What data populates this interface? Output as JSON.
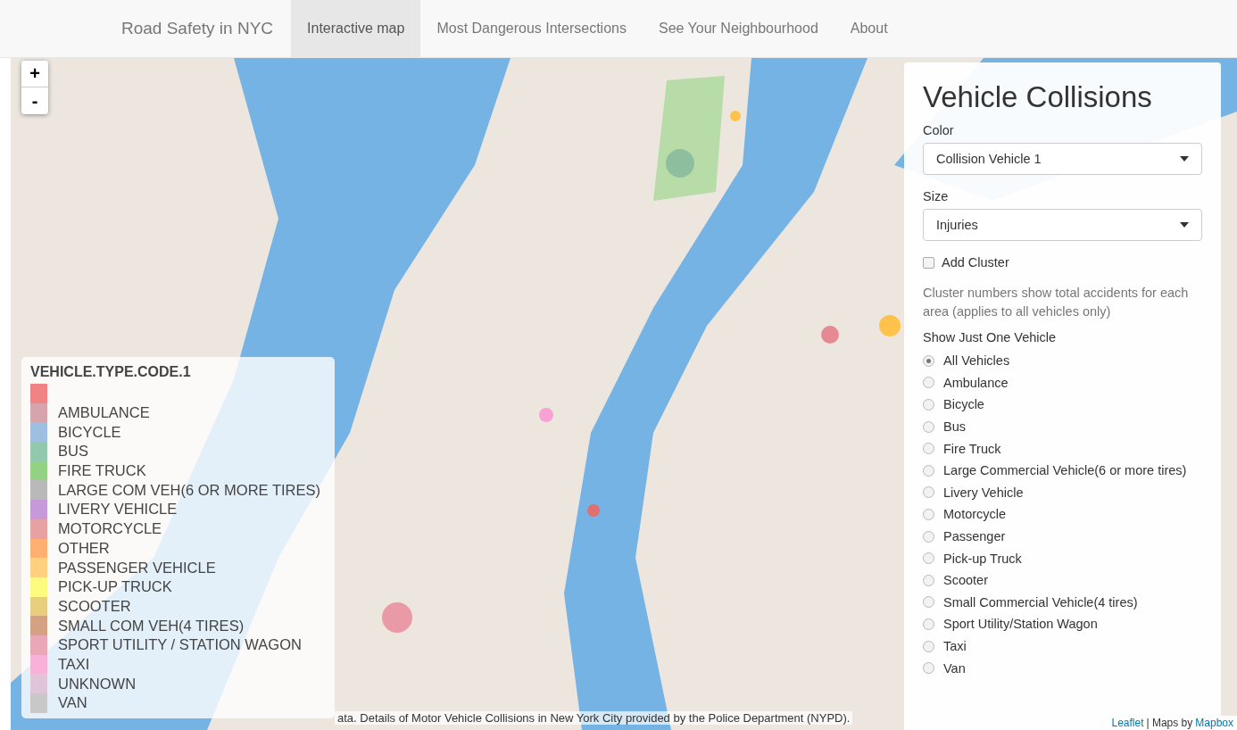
{
  "navbar": {
    "brand": "Road Safety in NYC",
    "tabs": [
      {
        "label": "Interactive map",
        "selected": true
      },
      {
        "label": "Most Dangerous Intersections",
        "selected": false
      },
      {
        "label": "See Your Neighbourhood",
        "selected": false
      },
      {
        "label": "About",
        "selected": false
      }
    ]
  },
  "map": {
    "kind": "picture",
    "zoom_in": "+",
    "zoom_out": "-"
  },
  "legend": {
    "title": "VEHICLE.TYPE.CODE.1",
    "items": [
      {
        "color": "#f08484"
      },
      {
        "label": "AMBULANCE",
        "color": "#d8a4ac"
      },
      {
        "label": "BICYCLE",
        "color": "#9fbfe0"
      },
      {
        "label": "BUS",
        "color": "#92c9ac"
      },
      {
        "label": "FIRE TRUCK",
        "color": "#94d184"
      },
      {
        "label": "LARGE COM VEH(6 OR MORE TIRES)",
        "color": "#b9b9b9"
      },
      {
        "label": "LIVERY VEHICLE",
        "color": "#c69ad8"
      },
      {
        "label": "MOTORCYCLE",
        "color": "#e6a2a2"
      },
      {
        "label": "OTHER",
        "color": "#ffb070"
      },
      {
        "label": "PASSENGER VEHICLE",
        "color": "#ffd07e"
      },
      {
        "label": "PICK-UP TRUCK",
        "color": "#fffa80"
      },
      {
        "label": "SCOOTER",
        "color": "#e8cf80"
      },
      {
        "label": "SMALL COM VEH(4 TIRES)",
        "color": "#d2a282"
      },
      {
        "label": "SPORT UTILITY / STATION WAGON",
        "color": "#e8a8b6"
      },
      {
        "label": "TAXI",
        "color": "#f8b2da"
      },
      {
        "label": "UNKNOWN",
        "color": "#e0c4d8"
      },
      {
        "label": "VAN",
        "color": "#c8c8c8"
      }
    ]
  },
  "attribution": {
    "text": "ata. Details of Motor Vehicle Collisions in New York City provided by the Police Department (NYPD).",
    "leaflet_link": "Leaflet",
    "separator": "| Maps by",
    "mapbox_link": "Mapbox"
  },
  "panel": {
    "title": "Vehicle Collisions",
    "color_label": "Color",
    "color_value": "Collision Vehicle 1",
    "size_label": "Size",
    "size_value": "Injuries",
    "cluster": {
      "label": "Add Cluster",
      "checked": false
    },
    "help": "Cluster numbers show total accidents for each area (applies to all vehicles only)",
    "vehicle_label": "Show Just One Vehicle",
    "vehicles": [
      {
        "label": "All Vehicles",
        "selected": true
      },
      {
        "label": "Ambulance",
        "selected": false
      },
      {
        "label": "Bicycle",
        "selected": false
      },
      {
        "label": "Bus",
        "selected": false
      },
      {
        "label": "Fire Truck",
        "selected": false
      },
      {
        "label": "Large Commercial Vehicle(6 or more tires)",
        "selected": false
      },
      {
        "label": "Livery Vehicle",
        "selected": false
      },
      {
        "label": "Motorcycle",
        "selected": false
      },
      {
        "label": "Passenger",
        "selected": false
      },
      {
        "label": "Pick-up Truck",
        "selected": false
      },
      {
        "label": "Scooter",
        "selected": false
      },
      {
        "label": "Small Commercial Vehicle(4 tires)",
        "selected": false
      },
      {
        "label": "Sport Utility/Station Wagon",
        "selected": false
      },
      {
        "label": "Taxi",
        "selected": false
      },
      {
        "label": "Van",
        "selected": false
      }
    ]
  }
}
